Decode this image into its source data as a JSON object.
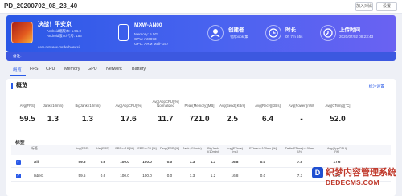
{
  "header": {
    "title": "PD_20200702_08_23_40",
    "buttons": [
      "加入对比",
      "设置"
    ]
  },
  "banner": {
    "app": {
      "name": "决战！平安京",
      "android_line1": "Android端版本: 1.56.0",
      "android_line2": "Android版本/代号: 156",
      "package": "com.netease.mrdw.huawei"
    },
    "device": {
      "name": "MXW-AN00",
      "memory": "Memory: 5.5G",
      "cpu": "CPU: mt6873",
      "gpu": "GPU: ARM Mali-G57"
    },
    "creator": {
      "label": "创建者",
      "value": "飞鸽book 集"
    },
    "duration": {
      "label": "时长",
      "value": "0h 7m 55s"
    },
    "upload": {
      "label": "上传时间",
      "value": "2020/07/02 08:23:43"
    },
    "remark": "备注:"
  },
  "tabs": [
    "概览",
    "FPS",
    "CPU",
    "Memory",
    "GPU",
    "Network",
    "Battery"
  ],
  "overview": {
    "title": "概览",
    "link": "标注设置",
    "metrics": [
      {
        "label": "Avg(FPS)",
        "value": "59.5"
      },
      {
        "label": "Jank(/10min)",
        "value": "1.3"
      },
      {
        "label": "BigJank(/10min)",
        "value": "1.3"
      },
      {
        "label": "Avg(AppCPU)[%]",
        "value": "17.6"
      },
      {
        "label": "Avg(AppCPU)[%] Normalized",
        "value": "11.7"
      },
      {
        "label": "Peak(Memory)[MB]",
        "value": "721.0"
      },
      {
        "label": "Avg(Send)[KB/s]",
        "value": "2.5"
      },
      {
        "label": "Avg(Recv)[KB/s]",
        "value": "6.4"
      },
      {
        "label": "Avg(Power)[mW]",
        "value": "-"
      },
      {
        "label": "Avg(CTemp)[°C]",
        "value": "52.0"
      }
    ]
  },
  "table": {
    "title": "标签",
    "columns": [
      "标签",
      "Avg(FPS)",
      "Var(FPS)",
      "FPS>=18 [%]",
      "FPS>=25 [%]",
      "Drop(FPS)[/h]",
      "Jank (/10min)",
      "BigJank (/10min)",
      "Avg(FTime) [ms]",
      "FTime>=100ms [%]",
      "Delta(FTime)>100ms [/h]",
      "Avg(AppCPU) [%]"
    ],
    "rows": [
      {
        "name": "All",
        "bold": true,
        "cells": [
          "59.5",
          "0.6",
          "100.0",
          "100.0",
          "0.0",
          "1.3",
          "1.3",
          "16.8",
          "0.0",
          "7.5",
          "17.6"
        ]
      },
      {
        "name": "label1",
        "bold": false,
        "cells": [
          "59.5",
          "0.6",
          "100.0",
          "100.0",
          "0.0",
          "1.3",
          "1.2",
          "16.8",
          "0.0",
          "7.3",
          "17.6"
        ]
      }
    ]
  },
  "watermark": {
    "logo": "D",
    "cn": "织梦内容管理系统",
    "en": "DEDECMS.COM"
  }
}
